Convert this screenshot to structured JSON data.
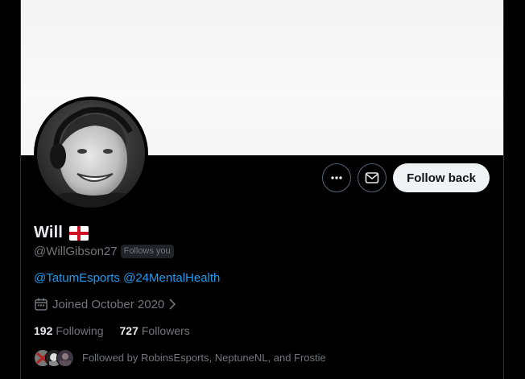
{
  "profile": {
    "name": "Will",
    "flag_icon": "england-flag-icon",
    "handle": "@WillGibson27",
    "follows_you": "Follows you",
    "bio_mentions": [
      "@TatumEsports",
      "@24MentalHealth"
    ],
    "joined": "Joined October 2020",
    "following_count": "192",
    "following_label": "Following",
    "followers_count": "727",
    "followers_label": "Followers",
    "followed_by": "Followed by RobinsEsports, NeptuneNL, and Frostie"
  },
  "actions": {
    "more_icon": "ellipsis-icon",
    "message_icon": "envelope-icon",
    "follow_label": "Follow back"
  },
  "colors": {
    "background": "#000000",
    "link": "#1d9bf0",
    "muted": "#71767b",
    "follow_button_bg": "#eff3f4"
  }
}
